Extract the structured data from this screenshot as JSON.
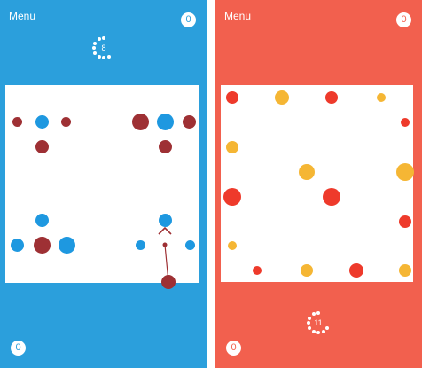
{
  "colors": {
    "blue_bg": "#2b9fdc",
    "red_bg": "#f2604e",
    "board": "#ffffff",
    "blue_dot": "#1e98e0",
    "maroon_dot": "#9e3034",
    "red_dot": "#ee3a2b",
    "yellow_dot": "#f5b634"
  },
  "left": {
    "menu_label": "Menu",
    "score_top": "0",
    "score_bottom": "0",
    "timer_value": "8"
  },
  "right": {
    "menu_label": "Menu",
    "score_top": "0",
    "score_bottom": "0",
    "timer_value": "11"
  }
}
